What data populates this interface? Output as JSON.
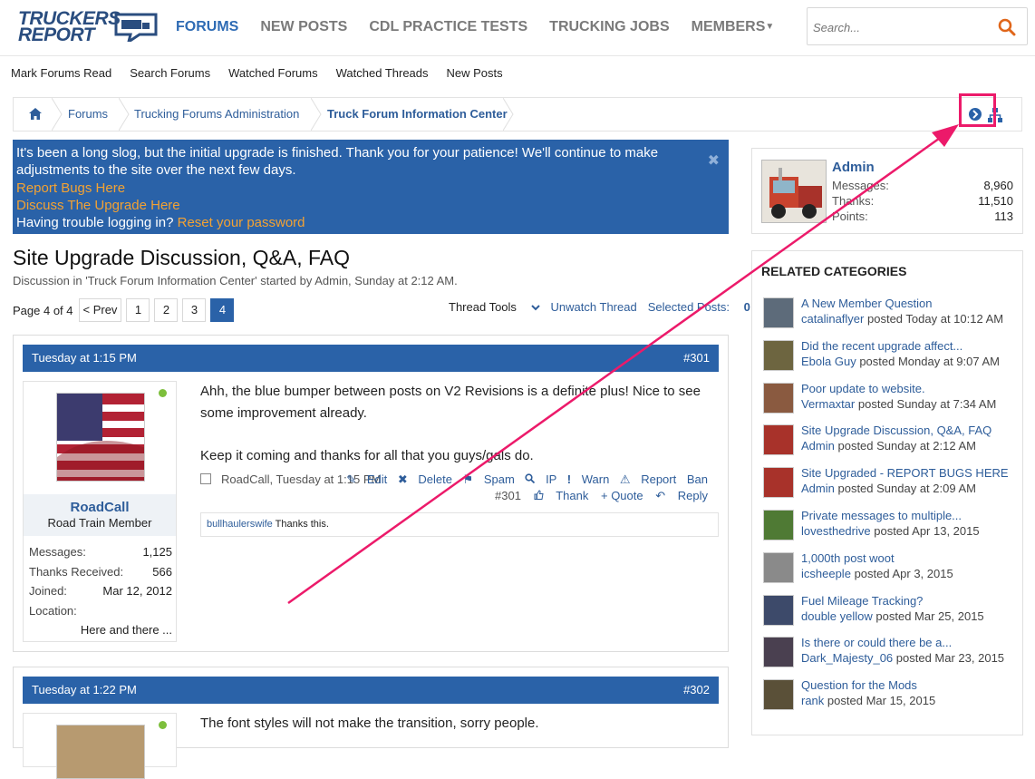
{
  "header": {
    "logo_line1": "TRUCKERS",
    "logo_line2": "REPORT",
    "nav": [
      "FORUMS",
      "NEW POSTS",
      "CDL PRACTICE TESTS",
      "TRUCKING JOBS",
      "MEMBERS"
    ],
    "search_placeholder": "Search..."
  },
  "subnav": [
    "Mark Forums Read",
    "Search Forums",
    "Watched Forums",
    "Watched Threads",
    "New Posts"
  ],
  "breadcrumb": [
    "Forums",
    "Trucking Forums Administration",
    "Truck Forum Information Center"
  ],
  "notice": {
    "line1": "It's been a long slog, but the initial upgrade is finished. Thank you for your patience! We'll continue to make adjustments to the site over the next few days.",
    "link1": "Report Bugs Here",
    "link2": "Discuss The Upgrade Here",
    "line_trouble": "Having trouble logging in?",
    "link3": "Reset your password",
    "close": "✖"
  },
  "thread": {
    "title": "Site Upgrade Discussion, Q&A, FAQ",
    "desc": "Discussion in 'Truck Forum Information Center' started by Admin, Sunday at 2:12 AM.",
    "page_label": "Page 4 of 4",
    "prev": "< Prev",
    "pages": [
      "1",
      "2",
      "3",
      "4"
    ],
    "tools": "Thread Tools",
    "unwatch": "Unwatch Thread",
    "selected": "Selected Posts:",
    "selected_count": "0"
  },
  "posts": [
    {
      "date": "Tuesday at 1:15 PM",
      "num": "#301",
      "username": "RoadCall",
      "usertitle": "Road Train Member",
      "stats": [
        {
          "k": "Messages:",
          "v": "1,125"
        },
        {
          "k": "Thanks Received:",
          "v": "566"
        },
        {
          "k": "Joined:",
          "v": "Mar 12, 2012"
        },
        {
          "k": "Location:",
          "v": ""
        }
      ],
      "location_value": "Here and there ...",
      "para1": "Ahh, the blue bumper between posts on V2 Revisions is a definite plus! Nice to see some improvement already.",
      "para2": "Keep it coming and thanks for all that you guys/gals do.",
      "meta": "RoadCall, Tuesday at 1:15 PM",
      "actions": [
        "Edit",
        "Delete",
        "Spam",
        "IP",
        "Warn",
        "Report",
        "Ban"
      ],
      "actions2": [
        "#301",
        "Thank",
        "+ Quote",
        "Reply"
      ],
      "like_user": "bullhaulerswife",
      "like_text": "Thanks this."
    },
    {
      "date": "Tuesday at 1:22 PM",
      "num": "#302",
      "para1": "The font styles will not make the transition, sorry people."
    }
  ],
  "visitor": {
    "name": "Admin",
    "stats": [
      {
        "k": "Messages:",
        "v": "8,960"
      },
      {
        "k": "Thanks:",
        "v": "11,510"
      },
      {
        "k": "Points:",
        "v": "113"
      }
    ]
  },
  "related": {
    "heading": "RELATED CATEGORIES",
    "items": [
      {
        "title": "A New Member Question",
        "user": "catalinaflyer",
        "when": "posted Today at 10:12 AM"
      },
      {
        "title": "Did the recent upgrade affect...",
        "user": "Ebola Guy",
        "when": "posted Monday at 9:07 AM"
      },
      {
        "title": "Poor update to website.",
        "user": "Vermaxtar",
        "when": "posted Sunday at 7:34 AM"
      },
      {
        "title": "Site Upgrade Discussion, Q&A, FAQ",
        "user": "Admin",
        "when": "posted Sunday at 2:12 AM"
      },
      {
        "title": "Site Upgraded - REPORT BUGS HERE",
        "user": "Admin",
        "when": "posted Sunday at 2:09 AM"
      },
      {
        "title": "Private messages to multiple...",
        "user": "lovesthedrive",
        "when": "posted Apr 13, 2015"
      },
      {
        "title": "1,000th post woot",
        "user": "icsheeple",
        "when": "posted Apr 3, 2015"
      },
      {
        "title": "Fuel Mileage Tracking?",
        "user": "double yellow",
        "when": "posted Mar 25, 2015"
      },
      {
        "title": "Is there or could there be a...",
        "user": "Dark_Majesty_06",
        "when": "posted Mar 23, 2015"
      },
      {
        "title": "Question for the Mods",
        "user": "rank",
        "when": "posted Mar 15, 2015"
      }
    ]
  },
  "colors": {
    "brand": "#2a62a8",
    "accent_link": "#f3a233",
    "annotation": "#ec1a6a"
  }
}
